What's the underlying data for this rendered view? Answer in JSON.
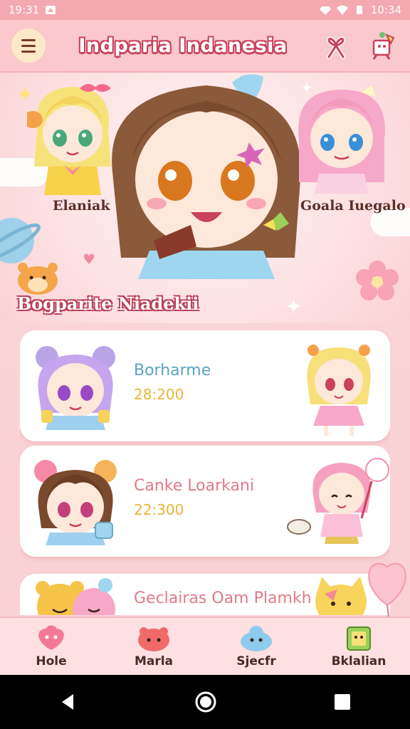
{
  "status_bar": {
    "time_left": "19:31",
    "time_right": "10:34"
  },
  "header": {
    "title": "Indparia Indanesia"
  },
  "hero": {
    "left_character": "Elaniak",
    "right_character": "Goala Iuegalo"
  },
  "section": {
    "title": "Bogparite Niadekii"
  },
  "list": [
    {
      "name": "Borharme",
      "time": "28:200",
      "name_color": "#5aa3c4"
    },
    {
      "name": "Canke Loarkani",
      "time": "22:300",
      "name_color": "#e07a8a"
    },
    {
      "name": "Geclairas Oam Plamkh",
      "time": "",
      "name_color": "#e07a8a"
    }
  ],
  "bottom_nav": [
    {
      "label": "Hole",
      "icon": "pink-blob-icon"
    },
    {
      "label": "Marla",
      "icon": "red-blob-icon"
    },
    {
      "label": "Sjecfr",
      "icon": "blue-blob-icon"
    },
    {
      "label": "Bklalian",
      "icon": "green-notebook-icon"
    }
  ],
  "colors": {
    "accent": "#e05a72",
    "header_bg": "#fbc9cc",
    "time": "#e8b63a"
  }
}
